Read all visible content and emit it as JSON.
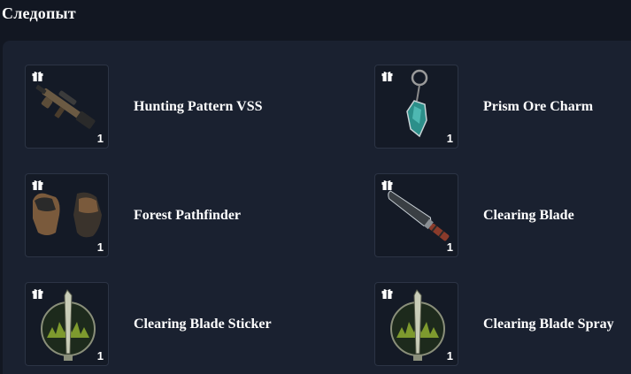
{
  "section": {
    "title": "Следопыт"
  },
  "items": [
    {
      "name": "Hunting Pattern VSS",
      "qty": "1",
      "icon": "rifle-icon"
    },
    {
      "name": "Prism Ore Charm",
      "qty": "1",
      "icon": "charm-icon"
    },
    {
      "name": "Forest Pathfinder",
      "qty": "1",
      "icon": "gloves-icon"
    },
    {
      "name": "Clearing Blade",
      "qty": "1",
      "icon": "knife-icon"
    },
    {
      "name": "Clearing Blade Sticker",
      "qty": "1",
      "icon": "sticker-icon"
    },
    {
      "name": "Clearing Blade Spray",
      "qty": "1",
      "icon": "spray-icon"
    }
  ],
  "colors": {
    "background": "#121722",
    "panel": "#1a2130",
    "tile": "#141a26",
    "tile_border": "#2c3445",
    "text": "#ffffff"
  }
}
